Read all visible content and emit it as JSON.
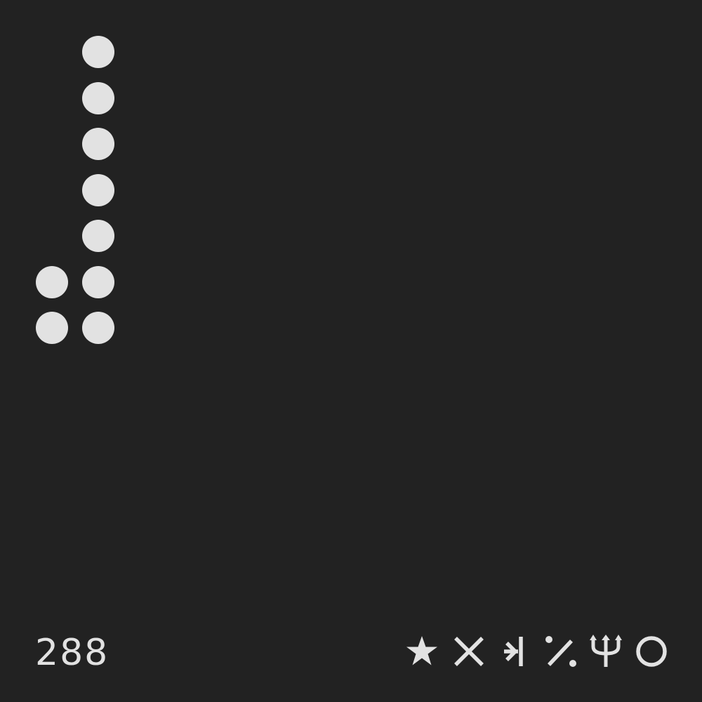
{
  "background_color": "#222222",
  "foreground_color": "#e2e2e2",
  "number": "288",
  "dot_grid": {
    "columns": 2,
    "rows": 7,
    "filled": [
      [
        false,
        true
      ],
      [
        false,
        true
      ],
      [
        false,
        true
      ],
      [
        false,
        true
      ],
      [
        false,
        true
      ],
      [
        true,
        true
      ],
      [
        true,
        true
      ]
    ]
  },
  "symbols": [
    "star-icon",
    "cross-icon",
    "arrow-to-bar-icon",
    "percent-slash-icon",
    "trident-icon",
    "circle-icon"
  ]
}
